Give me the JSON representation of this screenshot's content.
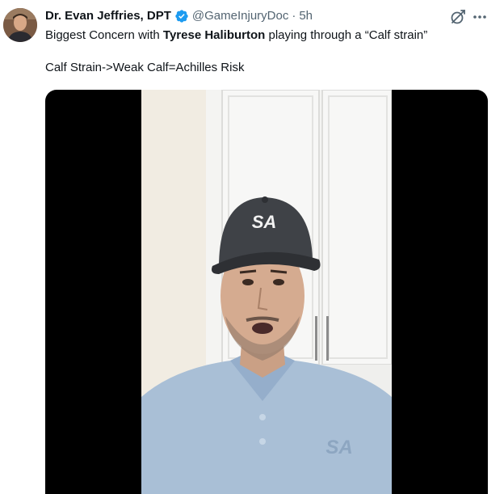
{
  "author": {
    "display_name": "Dr. Evan Jeffries, DPT",
    "handle": "@GameInjuryDoc",
    "separator": "·",
    "time": "5h"
  },
  "tweet": {
    "line1_prefix": "Biggest Concern with ",
    "line1_bold": "Tyrese Haliburton",
    "line1_suffix": " playing through a “Calf strain”",
    "line2": "Calf Strain->Weak Calf=Achilles Risk"
  },
  "media": {
    "cap_logo": "SA"
  },
  "icons": {
    "verified": "verified-badge-icon",
    "grok": "grok-icon",
    "more": "more-options-icon"
  },
  "colors": {
    "verified_blue": "#1d9bf0",
    "secondary_text": "#536471",
    "primary_text": "#0f1419"
  }
}
